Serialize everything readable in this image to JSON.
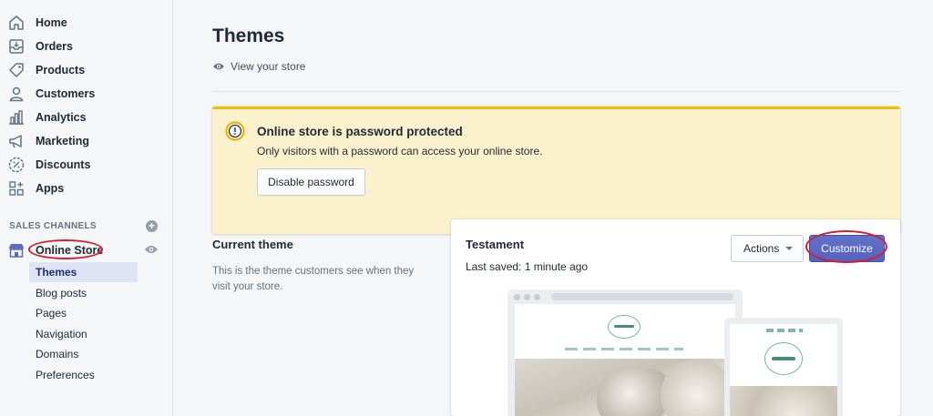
{
  "sidebar": {
    "items": [
      {
        "label": "Home",
        "icon": "home-icon"
      },
      {
        "label": "Orders",
        "icon": "orders-icon"
      },
      {
        "label": "Products",
        "icon": "tag-icon"
      },
      {
        "label": "Customers",
        "icon": "person-icon"
      },
      {
        "label": "Analytics",
        "icon": "bar-chart-icon"
      },
      {
        "label": "Marketing",
        "icon": "megaphone-icon"
      },
      {
        "label": "Discounts",
        "icon": "discount-icon"
      },
      {
        "label": "Apps",
        "icon": "apps-icon"
      }
    ],
    "sales_channels_title": "SALES CHANNELS",
    "online_store_label": "Online Store",
    "sub_items": [
      "Themes",
      "Blog posts",
      "Pages",
      "Navigation",
      "Domains",
      "Preferences"
    ],
    "active_sub_item": "Themes"
  },
  "main": {
    "title": "Themes",
    "view_store_label": "View your store",
    "banner": {
      "title": "Online store is password protected",
      "text": "Only visitors with a password can access your online store.",
      "button_label": "Disable password"
    },
    "current_theme": {
      "heading": "Current theme",
      "description": "This is the theme customers see when they visit your store.",
      "name": "Testament",
      "last_saved": "Last saved: 1 minute ago",
      "actions_label": "Actions",
      "customize_label": "Customize"
    }
  },
  "colors": {
    "accent": "#5c6ac4",
    "banner_bg": "#fcf1cd",
    "banner_border": "#eec200",
    "annotation_red": "#d41f2e"
  }
}
